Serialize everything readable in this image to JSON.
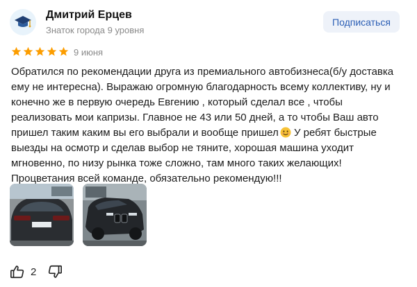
{
  "author": {
    "name": "Дмитрий Ерцев",
    "level": "Знаток города 9 уровня",
    "avatar_icon": "graduation-cap-icon"
  },
  "subscribe_label": "Подписаться",
  "rating": {
    "stars": 5,
    "max": 5,
    "color": "#fc9d00"
  },
  "date": "9 июня",
  "review": {
    "text_part1": "Обратился по рекомендации друга из премиального автобизнеса(б/у доставка ему не интересна). Выражаю огромную благодарность всему коллективу, ну и конечно же в первую очередь Евгению , который сделал все , чтобы реализовать мои капризы. Главное не 43 или 50 дней, а то чтобы Ваш авто пришел таким каким вы его выбрали и вообще пришел",
    "emoji": "smiling-face-emoji",
    "text_part2": "У ребят быстрые выезды на осмотр и сделав выбор не тяните, хорошая машина уходит мгновенно, по низу рынка тоже сложно, там много таких желающих! Процветания всей команде, обязательно рекомендую!!!"
  },
  "photos": [
    {
      "name": "photo-car-rear"
    },
    {
      "name": "photo-car-front"
    }
  ],
  "reactions": {
    "likes": "2",
    "like_icon": "thumbs-up-icon",
    "dislike_icon": "thumbs-down-icon"
  },
  "colors": {
    "accent": "#2c5fb5",
    "subscribe_bg": "#eef2f9",
    "muted": "#8a8a8a",
    "star": "#fc9d00"
  }
}
